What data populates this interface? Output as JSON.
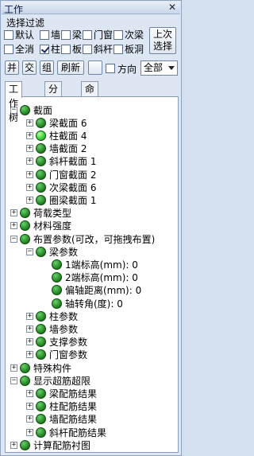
{
  "title": "工作",
  "close_glyph": "✕",
  "filter": {
    "label": "选择过滤",
    "row1": [
      "默认",
      "墙",
      "梁",
      "门窗",
      "次梁"
    ],
    "row1_checked": [
      false,
      false,
      false,
      false,
      false
    ],
    "row2": [
      "全消",
      "柱",
      "板",
      "斜杆",
      "板洞"
    ],
    "row2_checked": [
      false,
      true,
      false,
      false,
      false
    ],
    "last_select_btn": "上次\n选择"
  },
  "toolbar": {
    "buttons": [
      "并",
      "交",
      "组",
      "刷新"
    ],
    "direction_label": "方向",
    "direction_value": "全部"
  },
  "tabs": [
    "工作树",
    "分组",
    "命令树"
  ],
  "active_tab": 0,
  "tree": [
    {
      "label": "截面",
      "level": 0,
      "exp": "-"
    },
    {
      "label": "梁截面 6",
      "level": 1,
      "exp": "+"
    },
    {
      "label": "柱截面 4",
      "level": 1,
      "exp": "+",
      "bright": true
    },
    {
      "label": "墙截面 2",
      "level": 1,
      "exp": "+"
    },
    {
      "label": "斜杆截面 1",
      "level": 1,
      "exp": "+"
    },
    {
      "label": "门窗截面 2",
      "level": 1,
      "exp": "+"
    },
    {
      "label": "次梁截面 6",
      "level": 1,
      "exp": "+"
    },
    {
      "label": "圈梁截面 1",
      "level": 1,
      "exp": "+"
    },
    {
      "label": "荷载类型",
      "level": 0,
      "exp": "+"
    },
    {
      "label": "材料强度",
      "level": 0,
      "exp": "+"
    },
    {
      "label": "布置参数(可改，可拖拽布置)",
      "level": 0,
      "exp": "-"
    },
    {
      "label": "梁参数",
      "level": 1,
      "exp": "-"
    },
    {
      "label": "1端标高(mm): 0",
      "level": 2,
      "exp": ""
    },
    {
      "label": "2端标高(mm): 0",
      "level": 2,
      "exp": ""
    },
    {
      "label": "偏轴距离(mm): 0",
      "level": 2,
      "exp": ""
    },
    {
      "label": "轴转角(度): 0",
      "level": 2,
      "exp": ""
    },
    {
      "label": "柱参数",
      "level": 1,
      "exp": "+"
    },
    {
      "label": "墙参数",
      "level": 1,
      "exp": "+"
    },
    {
      "label": "支撑参数",
      "level": 1,
      "exp": "+"
    },
    {
      "label": "门窗参数",
      "level": 1,
      "exp": "+"
    },
    {
      "label": "特殊构件",
      "level": 0,
      "exp": "+"
    },
    {
      "label": "显示超筋超限",
      "level": 0,
      "exp": "-"
    },
    {
      "label": "梁配筋结果",
      "level": 1,
      "exp": "+"
    },
    {
      "label": "柱配筋结果",
      "level": 1,
      "exp": "+"
    },
    {
      "label": "墙配筋结果",
      "level": 1,
      "exp": "+"
    },
    {
      "label": "斜杆配筋结果",
      "level": 1,
      "exp": "+"
    },
    {
      "label": "计算配筋衬图",
      "level": 0,
      "exp": "+"
    }
  ]
}
